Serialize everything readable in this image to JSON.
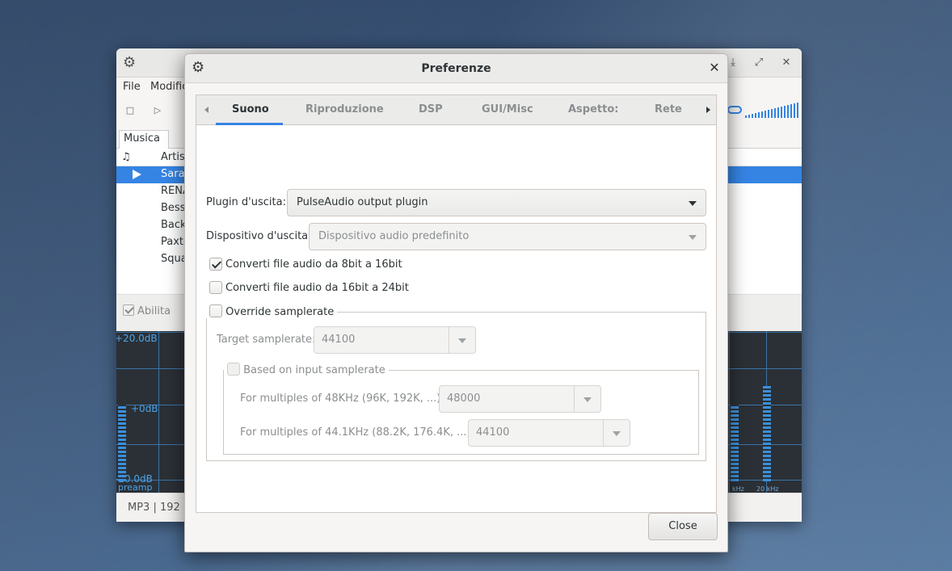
{
  "main_window": {
    "menu": [
      "File",
      "Modific"
    ],
    "music_tab": "Musica",
    "header": {
      "note_icon": "♫",
      "artist_col": "Artist"
    },
    "rows": [
      "Sarah",
      "RENA",
      "Besse",
      "Back",
      "Paxto",
      "Squa"
    ],
    "enable_label": "Abilita",
    "eq_labels": {
      "top": "+20.0dB",
      "mid": "+0dB",
      "bottom": "-20.0dB",
      "preamp": "preamp"
    },
    "eq_hz": [
      "kHz",
      "20 kHz"
    ],
    "status": "MP3 | 192 k"
  },
  "dialog": {
    "title": "Preferenze",
    "tabs": [
      "Suono",
      "Riproduzione",
      "DSP",
      "GUI/Misc",
      "Aspetto:",
      "Rete"
    ],
    "active_tab": "Suono",
    "output_plugin_label": "Plugin d'uscita:",
    "output_plugin_value": "PulseAudio output plugin",
    "output_device_label": "Dispositivo d'uscita:",
    "output_device_value": "Dispositivo audio predefinito",
    "convert_8_16": {
      "label": "Converti file audio da 8bit a 16bit",
      "checked": true
    },
    "convert_16_24": {
      "label": "Converti file audio da 16bit a 24bit",
      "checked": false
    },
    "override": {
      "label": "Override samplerate",
      "checked": false
    },
    "target_label": "Target samplerate:",
    "target_value": "44100",
    "based_on_input": {
      "label": "Based on input samplerate",
      "checked": false
    },
    "mult48_label": "For multiples of 48KHz (96K, 192K, ...):",
    "mult48_value": "48000",
    "mult441_label": "For multiples of 44.1KHz (88.2K, 176.4K, ...):",
    "mult441_value": "44100",
    "close_button": "Close"
  }
}
